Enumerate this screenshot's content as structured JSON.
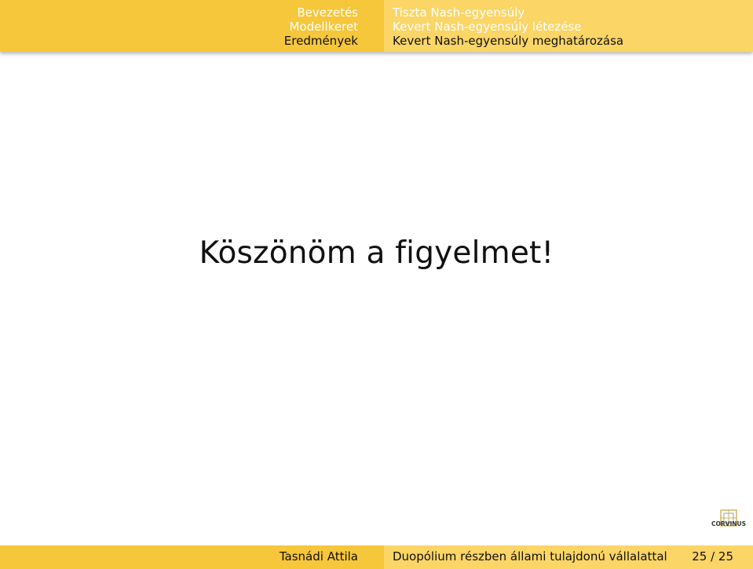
{
  "header": {
    "sections": [
      {
        "label": "Bevezetés",
        "active": false
      },
      {
        "label": "Modellkeret",
        "active": false
      },
      {
        "label": "Eredmények",
        "active": true
      }
    ],
    "subsections": [
      {
        "label": "Tiszta Nash-egyensúly",
        "active": false
      },
      {
        "label": "Kevert Nash-egyensúly létezése",
        "active": false
      },
      {
        "label": "Kevert Nash-egyensúly meghatározása",
        "active": true
      }
    ]
  },
  "main": {
    "title": "Köszönöm a figyelmet!"
  },
  "logo": {
    "text": "CORVINUS",
    "icon": "corvinus-logo-icon"
  },
  "footer": {
    "author": "Tasnádi Attila",
    "title": "Duopólium részben állami tulajdonú vállalattal",
    "page": "25 / 25"
  },
  "colors": {
    "header_left": "#f6c63b",
    "header_right": "#fbd566",
    "text": "#111111",
    "inactive_nav": "#ffffff"
  }
}
